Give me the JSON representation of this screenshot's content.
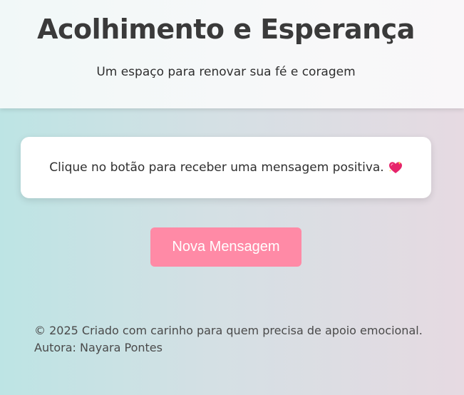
{
  "header": {
    "title": "Acolhimento e Esperança",
    "subtitle": "Um espaço para renovar sua fé e coragem"
  },
  "card": {
    "message": "Clique no botão para receber uma mensagem positiva.",
    "emoji_icon": "sparkling-heart-icon"
  },
  "button": {
    "label": "Nova Mensagem",
    "color": "#ff8aa6"
  },
  "footer": {
    "copyright": "© 2025 Criado com carinho para quem precisa de apoio emocional.",
    "author": "Autora: Nayara Pontes"
  },
  "colors": {
    "background_left": "#bde4e4",
    "background_right": "#e6dae2",
    "header_background": "#f5f8f8",
    "text": "#333333"
  }
}
